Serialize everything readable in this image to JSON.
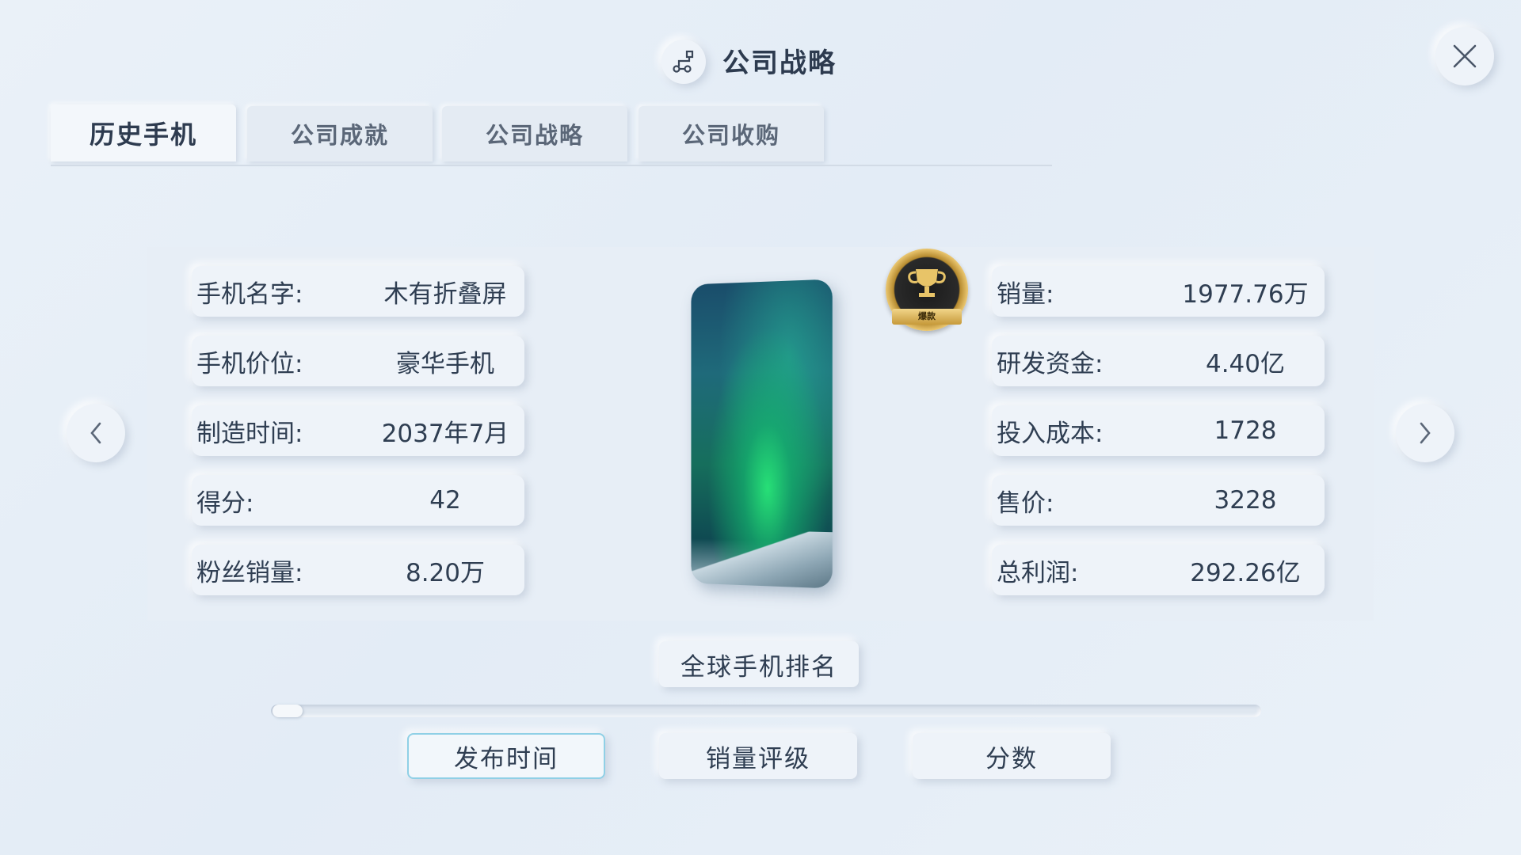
{
  "header": {
    "title": "公司战略",
    "icon": "strategy-nodes-icon"
  },
  "tabs": [
    {
      "label": "历史手机",
      "active": true
    },
    {
      "label": "公司成就",
      "active": false
    },
    {
      "label": "公司战略",
      "active": false
    },
    {
      "label": "公司收购",
      "active": false
    }
  ],
  "phone": {
    "left_fields": [
      {
        "label": "手机名字:",
        "value": "木有折叠屏"
      },
      {
        "label": "手机价位:",
        "value": "豪华手机"
      },
      {
        "label": "制造时间:",
        "value": "2037年7月"
      },
      {
        "label": "得分:",
        "value": "42"
      },
      {
        "label": "粉丝销量:",
        "value": "8.20万"
      }
    ],
    "right_fields": [
      {
        "label": "销量:",
        "value": "1977.76万"
      },
      {
        "label": "研发资金:",
        "value": "4.40亿"
      },
      {
        "label": "投入成本:",
        "value": "1728"
      },
      {
        "label": "售价:",
        "value": "3228"
      },
      {
        "label": "总利润:",
        "value": "292.26亿"
      }
    ],
    "badge_label": "爆款",
    "badge_icon": "trophy-icon"
  },
  "ranking": {
    "button_label": "全球手机排名",
    "progress": 0.0
  },
  "sort_buttons": [
    {
      "label": "发布时间",
      "selected": true
    },
    {
      "label": "销量评级",
      "selected": false
    },
    {
      "label": "分数",
      "selected": false
    }
  ],
  "icons": {
    "close": "close-icon",
    "prev": "chevron-left-icon",
    "next": "chevron-right-icon"
  },
  "colors": {
    "background": "#e6eef7",
    "selected_border": "#8fd0e6",
    "text": "#2f3e52"
  }
}
